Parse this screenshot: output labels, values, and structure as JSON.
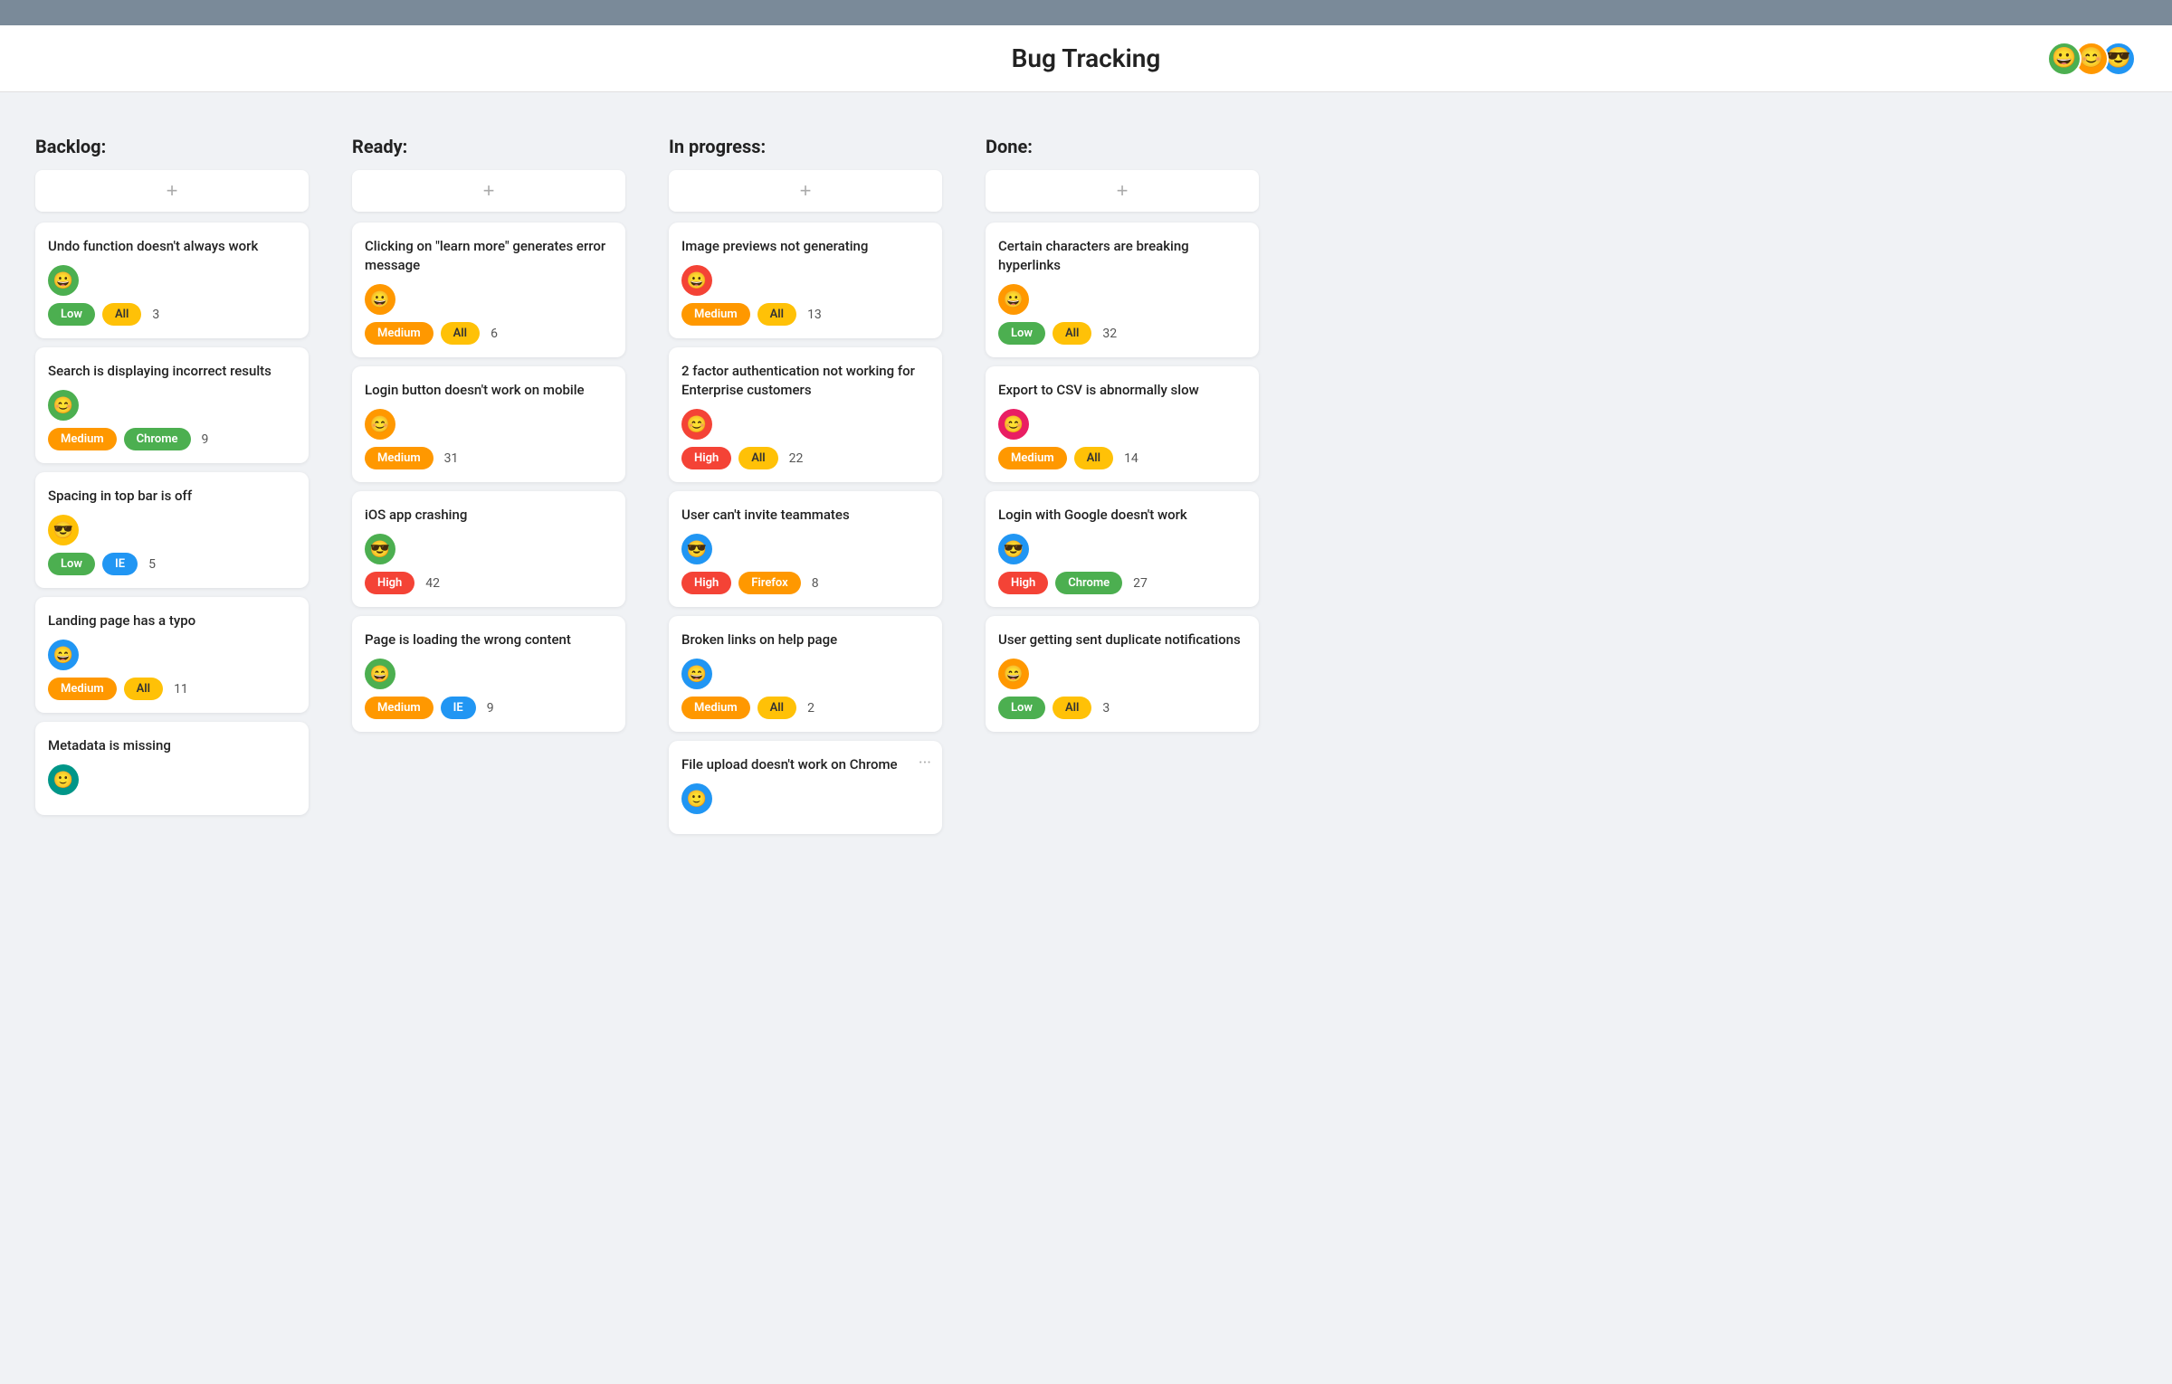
{
  "app": {
    "title": "Bug Tracking",
    "top_bar_label": "top bar"
  },
  "header": {
    "title": "Bug Tracking",
    "avatars": [
      {
        "id": "avatar-1",
        "color": "#4CAF50",
        "emoji": "👤"
      },
      {
        "id": "avatar-2",
        "color": "#FF9800",
        "emoji": "👤"
      },
      {
        "id": "avatar-3",
        "color": "#2196F3",
        "emoji": "👤"
      }
    ]
  },
  "columns": [
    {
      "id": "backlog",
      "label": "Backlog:",
      "add_label": "+",
      "cards": [
        {
          "title": "Undo function doesn't always work",
          "avatar_color": "#4CAF50",
          "priority": "Low",
          "priority_class": "badge-low",
          "platform": "All",
          "platform_class": "badge-all",
          "count": "3"
        },
        {
          "title": "Search is displaying incorrect results",
          "avatar_color": "#4CAF50",
          "priority": "Medium",
          "priority_class": "badge-medium",
          "platform": "Chrome",
          "platform_class": "badge-chrome",
          "count": "9"
        },
        {
          "title": "Spacing in top bar is off",
          "avatar_color": "#FFC107",
          "priority": "Low",
          "priority_class": "badge-low",
          "platform": "IE",
          "platform_class": "badge-ie",
          "count": "5"
        },
        {
          "title": "Landing page has a typo",
          "avatar_color": "#2196F3",
          "priority": "Medium",
          "priority_class": "badge-medium",
          "platform": "All",
          "platform_class": "badge-all",
          "count": "11"
        },
        {
          "title": "Metadata is missing",
          "avatar_color": "#009688",
          "priority": "",
          "priority_class": "",
          "platform": "",
          "platform_class": "",
          "count": ""
        }
      ]
    },
    {
      "id": "ready",
      "label": "Ready:",
      "add_label": "+",
      "cards": [
        {
          "title": "Clicking on \"learn more\" generates error message",
          "avatar_color": "#FF9800",
          "priority": "Medium",
          "priority_class": "badge-medium",
          "platform": "All",
          "platform_class": "badge-all",
          "count": "6"
        },
        {
          "title": "Login button doesn't work on mobile",
          "avatar_color": "#FF9800",
          "priority": "Medium",
          "priority_class": "badge-medium",
          "platform": "",
          "platform_class": "",
          "count": "31"
        },
        {
          "title": "iOS app crashing",
          "avatar_color": "#4CAF50",
          "priority": "High",
          "priority_class": "badge-high",
          "platform": "",
          "platform_class": "",
          "count": "42"
        },
        {
          "title": "Page is loading the wrong content",
          "avatar_color": "#4CAF50",
          "priority": "Medium",
          "priority_class": "badge-medium",
          "platform": "IE",
          "platform_class": "badge-ie",
          "count": "9"
        }
      ]
    },
    {
      "id": "in-progress",
      "label": "In progress:",
      "add_label": "+",
      "cards": [
        {
          "title": "Image previews not generating",
          "avatar_color": "#f44336",
          "priority": "Medium",
          "priority_class": "badge-medium",
          "platform": "All",
          "platform_class": "badge-all",
          "count": "13"
        },
        {
          "title": "2 factor authentication not working for Enterprise customers",
          "avatar_color": "#f44336",
          "priority": "High",
          "priority_class": "badge-high",
          "platform": "All",
          "platform_class": "badge-all",
          "count": "22"
        },
        {
          "title": "User can't invite teammates",
          "avatar_color": "#2196F3",
          "priority": "High",
          "priority_class": "badge-high",
          "platform": "Firefox",
          "platform_class": "badge-firefox",
          "count": "8"
        },
        {
          "title": "Broken links on help page",
          "avatar_color": "#2196F3",
          "priority": "Medium",
          "priority_class": "badge-medium",
          "platform": "All",
          "platform_class": "badge-all",
          "count": "2"
        },
        {
          "title": "File upload doesn't work on Chrome",
          "avatar_color": "#2196F3",
          "priority": "",
          "priority_class": "",
          "platform": "",
          "platform_class": "",
          "count": "",
          "has_more": true
        }
      ]
    },
    {
      "id": "done",
      "label": "Done:",
      "add_label": "+",
      "cards": [
        {
          "title": "Certain characters are breaking hyperlinks",
          "avatar_color": "#FF9800",
          "priority": "Low",
          "priority_class": "badge-low",
          "platform": "All",
          "platform_class": "badge-all",
          "count": "32"
        },
        {
          "title": "Export to CSV is abnormally slow",
          "avatar_color": "#E91E63",
          "priority": "Medium",
          "priority_class": "badge-medium",
          "platform": "All",
          "platform_class": "badge-all",
          "count": "14"
        },
        {
          "title": "Login with Google doesn't work",
          "avatar_color": "#2196F3",
          "priority": "High",
          "priority_class": "badge-high",
          "platform": "Chrome",
          "platform_class": "badge-chrome",
          "count": "27"
        },
        {
          "title": "User getting sent duplicate notifications",
          "avatar_color": "#FF9800",
          "priority": "Low",
          "priority_class": "badge-low",
          "platform": "All",
          "platform_class": "badge-all",
          "count": "3"
        }
      ]
    }
  ]
}
